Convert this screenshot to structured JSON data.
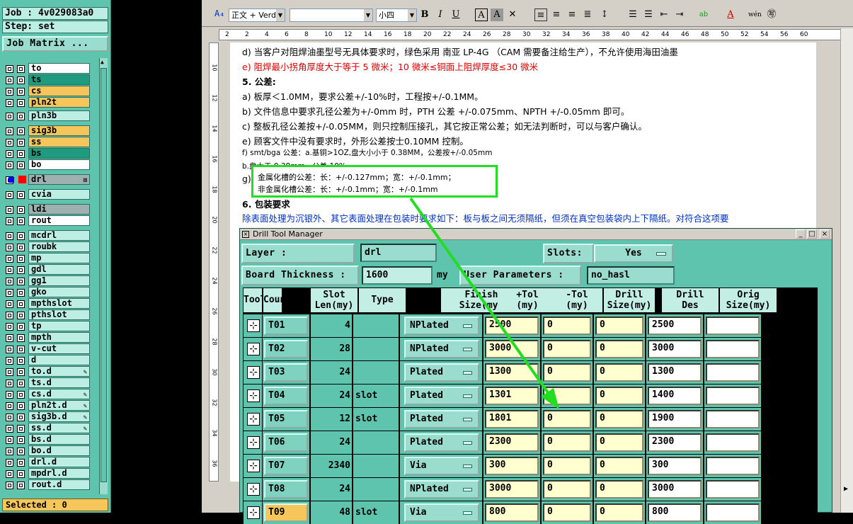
{
  "left_panel": {
    "job": "Job : 4v029083a0",
    "step": "Step: set",
    "job_matrix": "Job Matrix ...",
    "selected": "Selected : 0",
    "layers": [
      {
        "name": "to",
        "color": "#ffffff",
        "group": 1
      },
      {
        "name": "ts",
        "color": "#1f9b7f",
        "group": 1
      },
      {
        "name": "cs",
        "color": "#f7c65a",
        "group": 1
      },
      {
        "name": "pln2t",
        "color": "#f7c65a",
        "group": 1
      },
      {
        "name": "pln3b",
        "color": "#bdeee3",
        "group": 2
      },
      {
        "name": "sig3b",
        "color": "#f7c65a",
        "group": 3
      },
      {
        "name": "ss",
        "color": "#f7c65a",
        "group": 3
      },
      {
        "name": "bs",
        "color": "#1f9b7f",
        "group": 3
      },
      {
        "name": "bo",
        "color": "#ffffff",
        "group": 3
      },
      {
        "name": "drl",
        "color": "#9fb0b0",
        "group": 4,
        "tag": "⊞"
      },
      {
        "name": "cvia",
        "color": "#bdeee3",
        "group": 5
      },
      {
        "name": "ldi",
        "color": "#9fb0b0",
        "group": 6
      },
      {
        "name": "rout",
        "color": "#ffffff",
        "group": 6
      },
      {
        "name": "mcdrl",
        "color": "#bdeee3",
        "group": 7
      },
      {
        "name": "roubk",
        "color": "#bdeee3",
        "group": 7
      },
      {
        "name": "mp",
        "color": "#bdeee3",
        "group": 7
      },
      {
        "name": "gdl",
        "color": "#bdeee3",
        "group": 7
      },
      {
        "name": "gg1",
        "color": "#bdeee3",
        "group": 7
      },
      {
        "name": "gko",
        "color": "#bdeee3",
        "group": 7
      },
      {
        "name": "mpthslot",
        "color": "#bdeee3",
        "group": 7
      },
      {
        "name": "pthslot",
        "color": "#bdeee3",
        "group": 7
      },
      {
        "name": "tp",
        "color": "#bdeee3",
        "group": 7
      },
      {
        "name": "mpth",
        "color": "#bdeee3",
        "group": 7
      },
      {
        "name": "v-cut",
        "color": "#bdeee3",
        "group": 7
      },
      {
        "name": "d",
        "color": "#bdeee3",
        "group": 7
      },
      {
        "name": "to.d",
        "color": "#bdeee3",
        "group": 7,
        "tag": "✎"
      },
      {
        "name": "ts.d",
        "color": "#bdeee3",
        "group": 7
      },
      {
        "name": "cs.d",
        "color": "#bdeee3",
        "group": 7,
        "tag": "✎"
      },
      {
        "name": "pln2t.d",
        "color": "#bdeee3",
        "group": 7,
        "tag": "✎"
      },
      {
        "name": "sig3b.d",
        "color": "#bdeee3",
        "group": 7,
        "tag": "✎"
      },
      {
        "name": "ss.d",
        "color": "#bdeee3",
        "group": 7,
        "tag": "✎"
      },
      {
        "name": "bs.d",
        "color": "#bdeee3",
        "group": 7
      },
      {
        "name": "bo.d",
        "color": "#bdeee3",
        "group": 7
      },
      {
        "name": "drl.d",
        "color": "#bdeee3",
        "group": 7
      },
      {
        "name": "mpdrl.d",
        "color": "#bdeee3",
        "group": 7
      },
      {
        "name": "rout.d",
        "color": "#bdeee3",
        "group": 7
      }
    ]
  },
  "word": {
    "toolbar": {
      "style": "正文 + Verd",
      "font": "",
      "size": "小四",
      "bold": "B",
      "italic": "I",
      "underline": "U"
    },
    "ruler": [
      "2",
      "2",
      "4",
      "6",
      "8",
      "10",
      "12",
      "14",
      "16",
      "18",
      "20",
      "22",
      "24",
      "26",
      "28",
      "30",
      "32",
      "34",
      "36",
      "38",
      "40",
      "42",
      "44",
      "46",
      "48",
      "50",
      "52",
      "54",
      "56",
      "60"
    ],
    "vruler": [
      "10",
      "12",
      "14",
      "16",
      "18",
      "20",
      "22",
      "24",
      "26",
      "28",
      "30",
      "32",
      "34",
      "36"
    ],
    "lines": [
      {
        "text": "d)   当客户对阻焊油墨型号无具体要求时，绿色采用 南亚 LP-4G （CAM 需要备注给生产），不允许使用海田油墨",
        "cls": ""
      },
      {
        "text": "e)   阻焊最小拐角厚度大于等于 5 微米；10 微米≤铜面上阻焊厚度≤30 微米",
        "cls": "red"
      },
      {
        "text": "5.    公差:",
        "cls": "bold"
      },
      {
        "text": "a)   板厚＜1.0MM，要求公差+/-10%时，工程按+/-0.1MM。",
        "cls": ""
      },
      {
        "text": "b)   文件信息中要求孔径公差为+/-0mm 时，PTH 公差  +/-0.075mm、NPTH +/-0.05mm 即可。",
        "cls": ""
      },
      {
        "text": "c)   整板孔径公差按+/-0.05MM，则只控制压接孔，其它按正常公差；如无法判断时，可以与客户确认。",
        "cls": ""
      },
      {
        "text": "e)   顾客文件中没有要求时，外形公差按士0.10MM 控制。",
        "cls": ""
      },
      {
        "text": "f)   smt/bga 公差：a.基铜>1OZ,盘大小小于 0.38MM，公差按+/-0.05mm",
        "cls": "small"
      },
      {
        "text": "                 b.盘大于 0.38mm，公差 10%",
        "cls": "small"
      },
      {
        "text": "g)",
        "cls": ""
      },
      {
        "text": "6.    包装要求",
        "cls": "bold"
      },
      {
        "text": "       除表面处理为沉银外、其它表面处理在包装时要求如下：板与板之间无须隔纸，但须在真空包装袋内上下隔纸。对符合这项要",
        "cls": "blue"
      }
    ],
    "callout": [
      "金属化槽的公差：长：+/-0.127mm；宽：+/-0.1mm；",
      "非金属化槽公差：长：+/-0.1mm；宽：+/-0.1mm"
    ]
  },
  "dtm": {
    "title": "Drill Tool Manager",
    "layer_label": "Layer              :",
    "layer_value": "drl",
    "slots_label": "Slots:",
    "slots_value": "Yes",
    "thickness_label": "Board Thickness  :",
    "thickness_value": "1600",
    "thickness_unit": "my",
    "user_params_label": "User Parameters  :",
    "user_params_value": "no_hasl",
    "headers": [
      "Tool",
      "Count",
      "Slot\nLen(my)",
      "Type",
      "Finish\nSize(my)",
      "+Tol\n(my)",
      "-Tol\n(my)",
      "Drill\nSize(my)",
      "Drill\nDes",
      "Orig\nSize(my)"
    ],
    "rows": [
      {
        "tool": "T01",
        "count": "4",
        "slot": "",
        "type": "NPlated",
        "finish": "2500",
        "ptol": "0",
        "ntol": "0",
        "drill": "2500",
        "des": "",
        "orig": ""
      },
      {
        "tool": "T02",
        "count": "28",
        "slot": "",
        "type": "NPlated",
        "finish": "3000",
        "ptol": "0",
        "ntol": "0",
        "drill": "3000",
        "des": "",
        "orig": ""
      },
      {
        "tool": "T03",
        "count": "24",
        "slot": "",
        "type": "Plated",
        "finish": "1300",
        "ptol": "0",
        "ntol": "0",
        "drill": "1300",
        "des": "",
        "orig": ""
      },
      {
        "tool": "T04",
        "count": "24",
        "slot": "slot",
        "type": "Plated",
        "finish": "1301",
        "ptol": "",
        "ntol": "0",
        "drill": "1400",
        "des": "",
        "orig": ""
      },
      {
        "tool": "T05",
        "count": "12",
        "slot": "slot",
        "type": "Plated",
        "finish": "1801",
        "ptol": "0",
        "ntol": "0",
        "drill": "1900",
        "des": "",
        "orig": ""
      },
      {
        "tool": "T06",
        "count": "24",
        "slot": "",
        "type": "Plated",
        "finish": "2300",
        "ptol": "0",
        "ntol": "0",
        "drill": "2300",
        "des": "",
        "orig": ""
      },
      {
        "tool": "T07",
        "count": "2340",
        "slot": "",
        "type": "Via",
        "finish": "300",
        "ptol": "0",
        "ntol": "0",
        "drill": "300",
        "des": "",
        "orig": ""
      },
      {
        "tool": "T08",
        "count": "24",
        "slot": "",
        "type": "NPlated",
        "finish": "3000",
        "ptol": "0",
        "ntol": "0",
        "drill": "3000",
        "des": "",
        "orig": ""
      },
      {
        "tool": "T09",
        "count": "48",
        "slot": "slot",
        "type": "Via",
        "finish": "800",
        "ptol": "0",
        "ntol": "0",
        "drill": "800",
        "des": "",
        "orig": ""
      }
    ]
  }
}
